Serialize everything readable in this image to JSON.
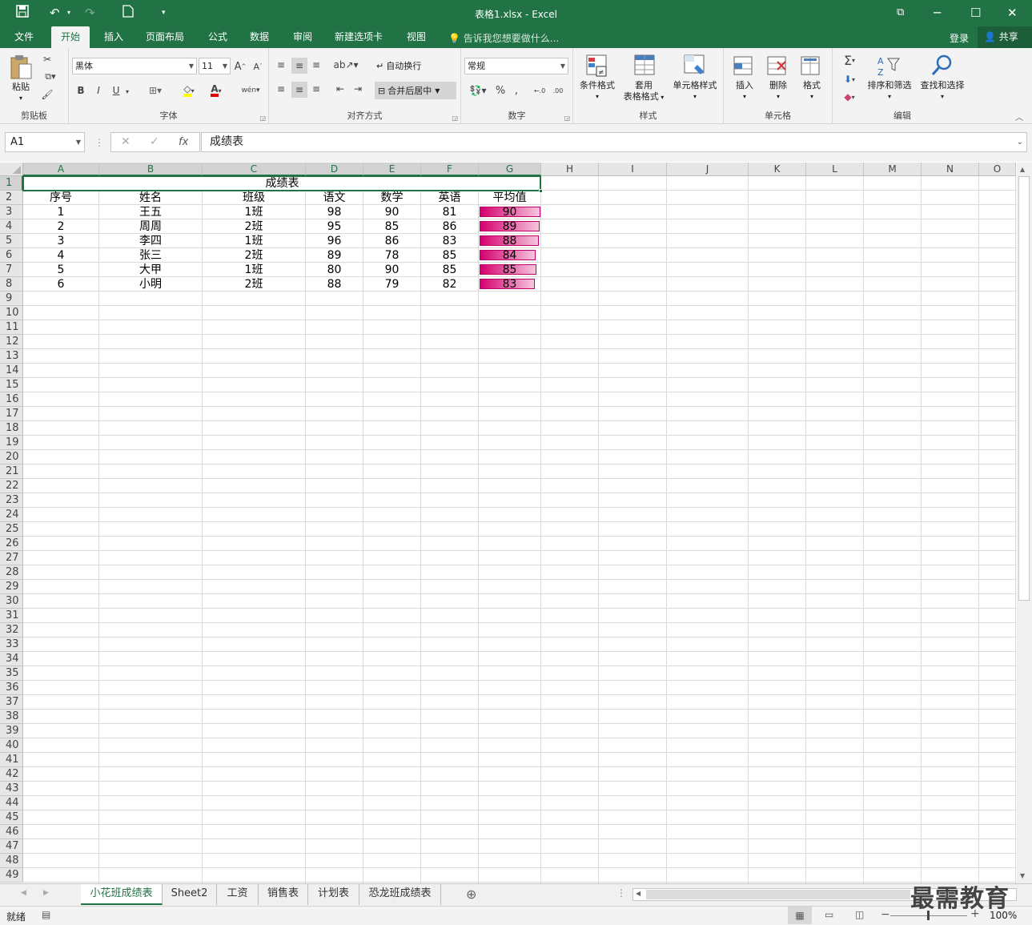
{
  "window": {
    "title": "表格1.xlsx - Excel"
  },
  "menu": {
    "tabs": [
      "文件",
      "开始",
      "插入",
      "页面布局",
      "公式",
      "数据",
      "审阅",
      "新建选项卡",
      "视图"
    ],
    "active_tab": "开始",
    "tell_me": "告诉我您想要做什么...",
    "login": "登录",
    "share": "共享"
  },
  "ribbon": {
    "clipboard": {
      "label": "剪贴板",
      "paste": "粘贴"
    },
    "font": {
      "label": "字体",
      "font_name": "黑体",
      "font_size": "11",
      "bold": "B",
      "italic": "I",
      "underline": "U"
    },
    "alignment": {
      "label": "对齐方式",
      "wrap": "自动换行",
      "merge": "合并后居中"
    },
    "number": {
      "label": "数字",
      "format": "常规"
    },
    "styles": {
      "label": "样式",
      "conditional": "条件格式",
      "table_a": "套用",
      "table_b": "表格格式",
      "cell_styles": "单元格样式"
    },
    "cells": {
      "label": "单元格",
      "insert": "插入",
      "delete": "删除",
      "format": "格式"
    },
    "editing": {
      "label": "编辑",
      "sort": "排序和筛选",
      "find": "查找和选择"
    }
  },
  "formula_bar": {
    "name_box": "A1",
    "content": "成绩表"
  },
  "columns": [
    "A",
    "B",
    "C",
    "D",
    "E",
    "F",
    "G",
    "H",
    "I",
    "J",
    "K",
    "L",
    "M",
    "N",
    "O"
  ],
  "rows": [
    "1",
    "2",
    "3",
    "4",
    "5",
    "6",
    "7",
    "8",
    "9",
    "10",
    "11",
    "12",
    "13",
    "14",
    "15",
    "16",
    "17",
    "18",
    "19",
    "20",
    "21",
    "22",
    "23",
    "24",
    "25",
    "26",
    "27",
    "28",
    "29",
    "30",
    "31",
    "32",
    "33",
    "34",
    "35",
    "36",
    "37",
    "38",
    "39",
    "40",
    "41",
    "42",
    "43",
    "44",
    "45",
    "46",
    "47",
    "48",
    "49"
  ],
  "table": {
    "title": "成绩表",
    "headers": [
      "序号",
      "姓名",
      "班级",
      "语文",
      "数学",
      "英语",
      "平均值"
    ],
    "rows": [
      [
        "1",
        "王五",
        "1班",
        "98",
        "90",
        "81",
        "90"
      ],
      [
        "2",
        "周周",
        "2班",
        "95",
        "85",
        "86",
        "89"
      ],
      [
        "3",
        "李四",
        "1班",
        "96",
        "86",
        "83",
        "88"
      ],
      [
        "4",
        "张三",
        "2班",
        "89",
        "78",
        "85",
        "84"
      ],
      [
        "5",
        "大甲",
        "1班",
        "80",
        "90",
        "85",
        "85"
      ],
      [
        "6",
        "小明",
        "2班",
        "88",
        "79",
        "82",
        "83"
      ]
    ],
    "databar_color": "#d4006e"
  },
  "sheet_tabs": [
    "小花班成绩表",
    "Sheet2",
    "工资",
    "销售表",
    "计划表",
    "恐龙班成绩表"
  ],
  "active_sheet": "小花班成绩表",
  "status": {
    "ready": "就绪",
    "zoom": "100%"
  },
  "watermark": "最需教育",
  "colors": {
    "excel_green": "#217346"
  }
}
